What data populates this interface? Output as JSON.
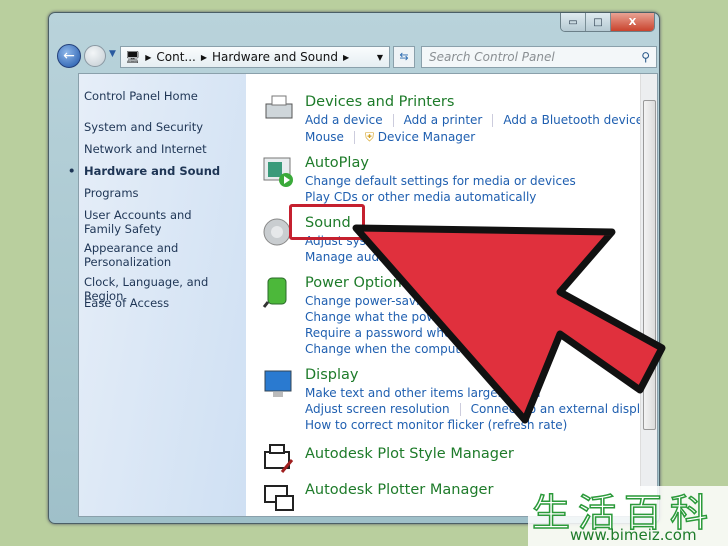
{
  "window": {
    "minimize": "▭",
    "maximize": "□",
    "close": "X"
  },
  "nav": {
    "back_icon": "back-arrow-icon",
    "breadcrumb": [
      "Cont...",
      "Hardware and Sound"
    ],
    "search_placeholder": "Search Control Panel"
  },
  "sidebar": {
    "items": [
      {
        "label": "Control Panel Home"
      },
      {
        "label": "System and Security"
      },
      {
        "label": "Network and Internet"
      },
      {
        "label": "Hardware and Sound",
        "active": true
      },
      {
        "label": "Programs"
      },
      {
        "label": "User Accounts and Family Safety"
      },
      {
        "label": "Appearance and Personalization"
      },
      {
        "label": "Clock, Language, and Region"
      },
      {
        "label": "Ease of Access"
      }
    ]
  },
  "categories": [
    {
      "title": "Devices and Printers",
      "links": [
        [
          "Add a device",
          "Add a printer",
          "Add a Bluetooth device"
        ],
        [
          "Mouse",
          "Device Manager"
        ]
      ]
    },
    {
      "title": "AutoPlay",
      "links": [
        [
          "Change default settings for media or devices"
        ],
        [
          "Play CDs or other media automatically"
        ]
      ]
    },
    {
      "title": "Sound",
      "links": [
        [
          "Adjust sys"
        ],
        [
          "Manage audi"
        ]
      ]
    },
    {
      "title": "Power Options",
      "links": [
        [
          "Change power-saving"
        ],
        [
          "Change what the power"
        ],
        [
          "Require a password when"
        ],
        [
          "Change when the computer s"
        ]
      ]
    },
    {
      "title": "Display",
      "links": [
        [
          "Make text and other items larger or sm"
        ],
        [
          "Adjust screen resolution",
          "Connect to an external display"
        ],
        [
          "How to correct monitor flicker (refresh rate)"
        ]
      ]
    },
    {
      "title": "Autodesk Plot Style Manager",
      "links": []
    },
    {
      "title": "Autodesk Plotter Manager",
      "links": []
    }
  ],
  "annotation": {
    "highlight_color": "#c5202f",
    "arrow_color": "#e0303d"
  },
  "watermark": {
    "text": "生活百科",
    "url": "www.bimeiz.com"
  }
}
